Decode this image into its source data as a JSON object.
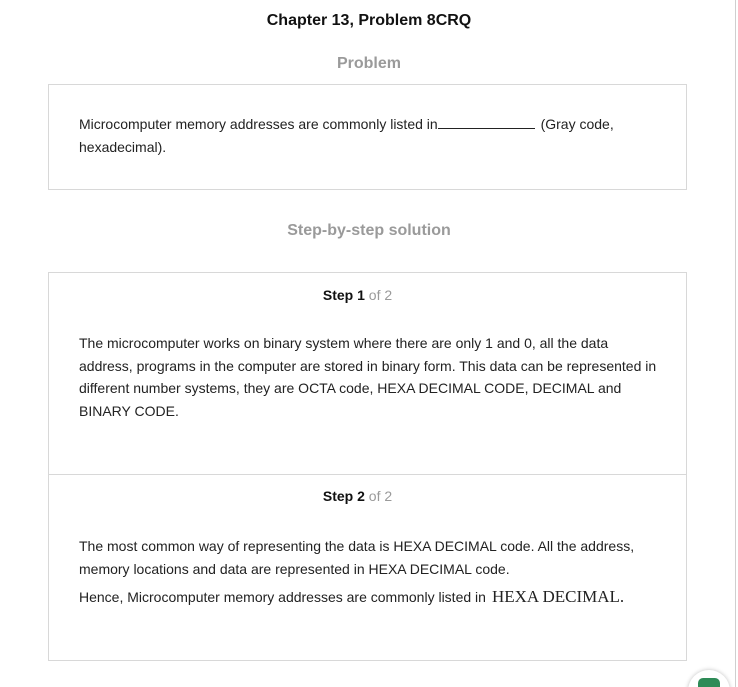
{
  "header": {
    "chapter_title": "Chapter 13, Problem 8CRQ"
  },
  "problem": {
    "heading": "Problem",
    "text_before_blank": "Microcomputer memory addresses are commonly listed in",
    "text_after_blank": " (Gray code, hexadecimal)."
  },
  "solution": {
    "heading": "Step-by-step solution",
    "steps": [
      {
        "label_prefix": "Step ",
        "number": "1",
        "of_total": " of 2",
        "paragraphs": [
          "The microcomputer works on binary system where there are only 1 and 0, all the data address, programs in the computer are stored in binary form. This data can be represented in different number systems, they are OCTA code, HEXA DECIMAL CODE, DECIMAL and BINARY CODE."
        ]
      },
      {
        "label_prefix": "Step ",
        "number": "2",
        "of_total": " of 2",
        "paragraphs": [
          "The most common way of representing the data is HEXA DECIMAL code. All the address, memory locations and data are represented in HEXA DECIMAL code.",
          "Hence, Microcomputer memory addresses are commonly listed in"
        ],
        "answer": "HEXA DECIMAL",
        "answer_punct": "."
      }
    ]
  },
  "floating_button": {
    "icon": "chat-icon",
    "color": "#2e8b57"
  }
}
